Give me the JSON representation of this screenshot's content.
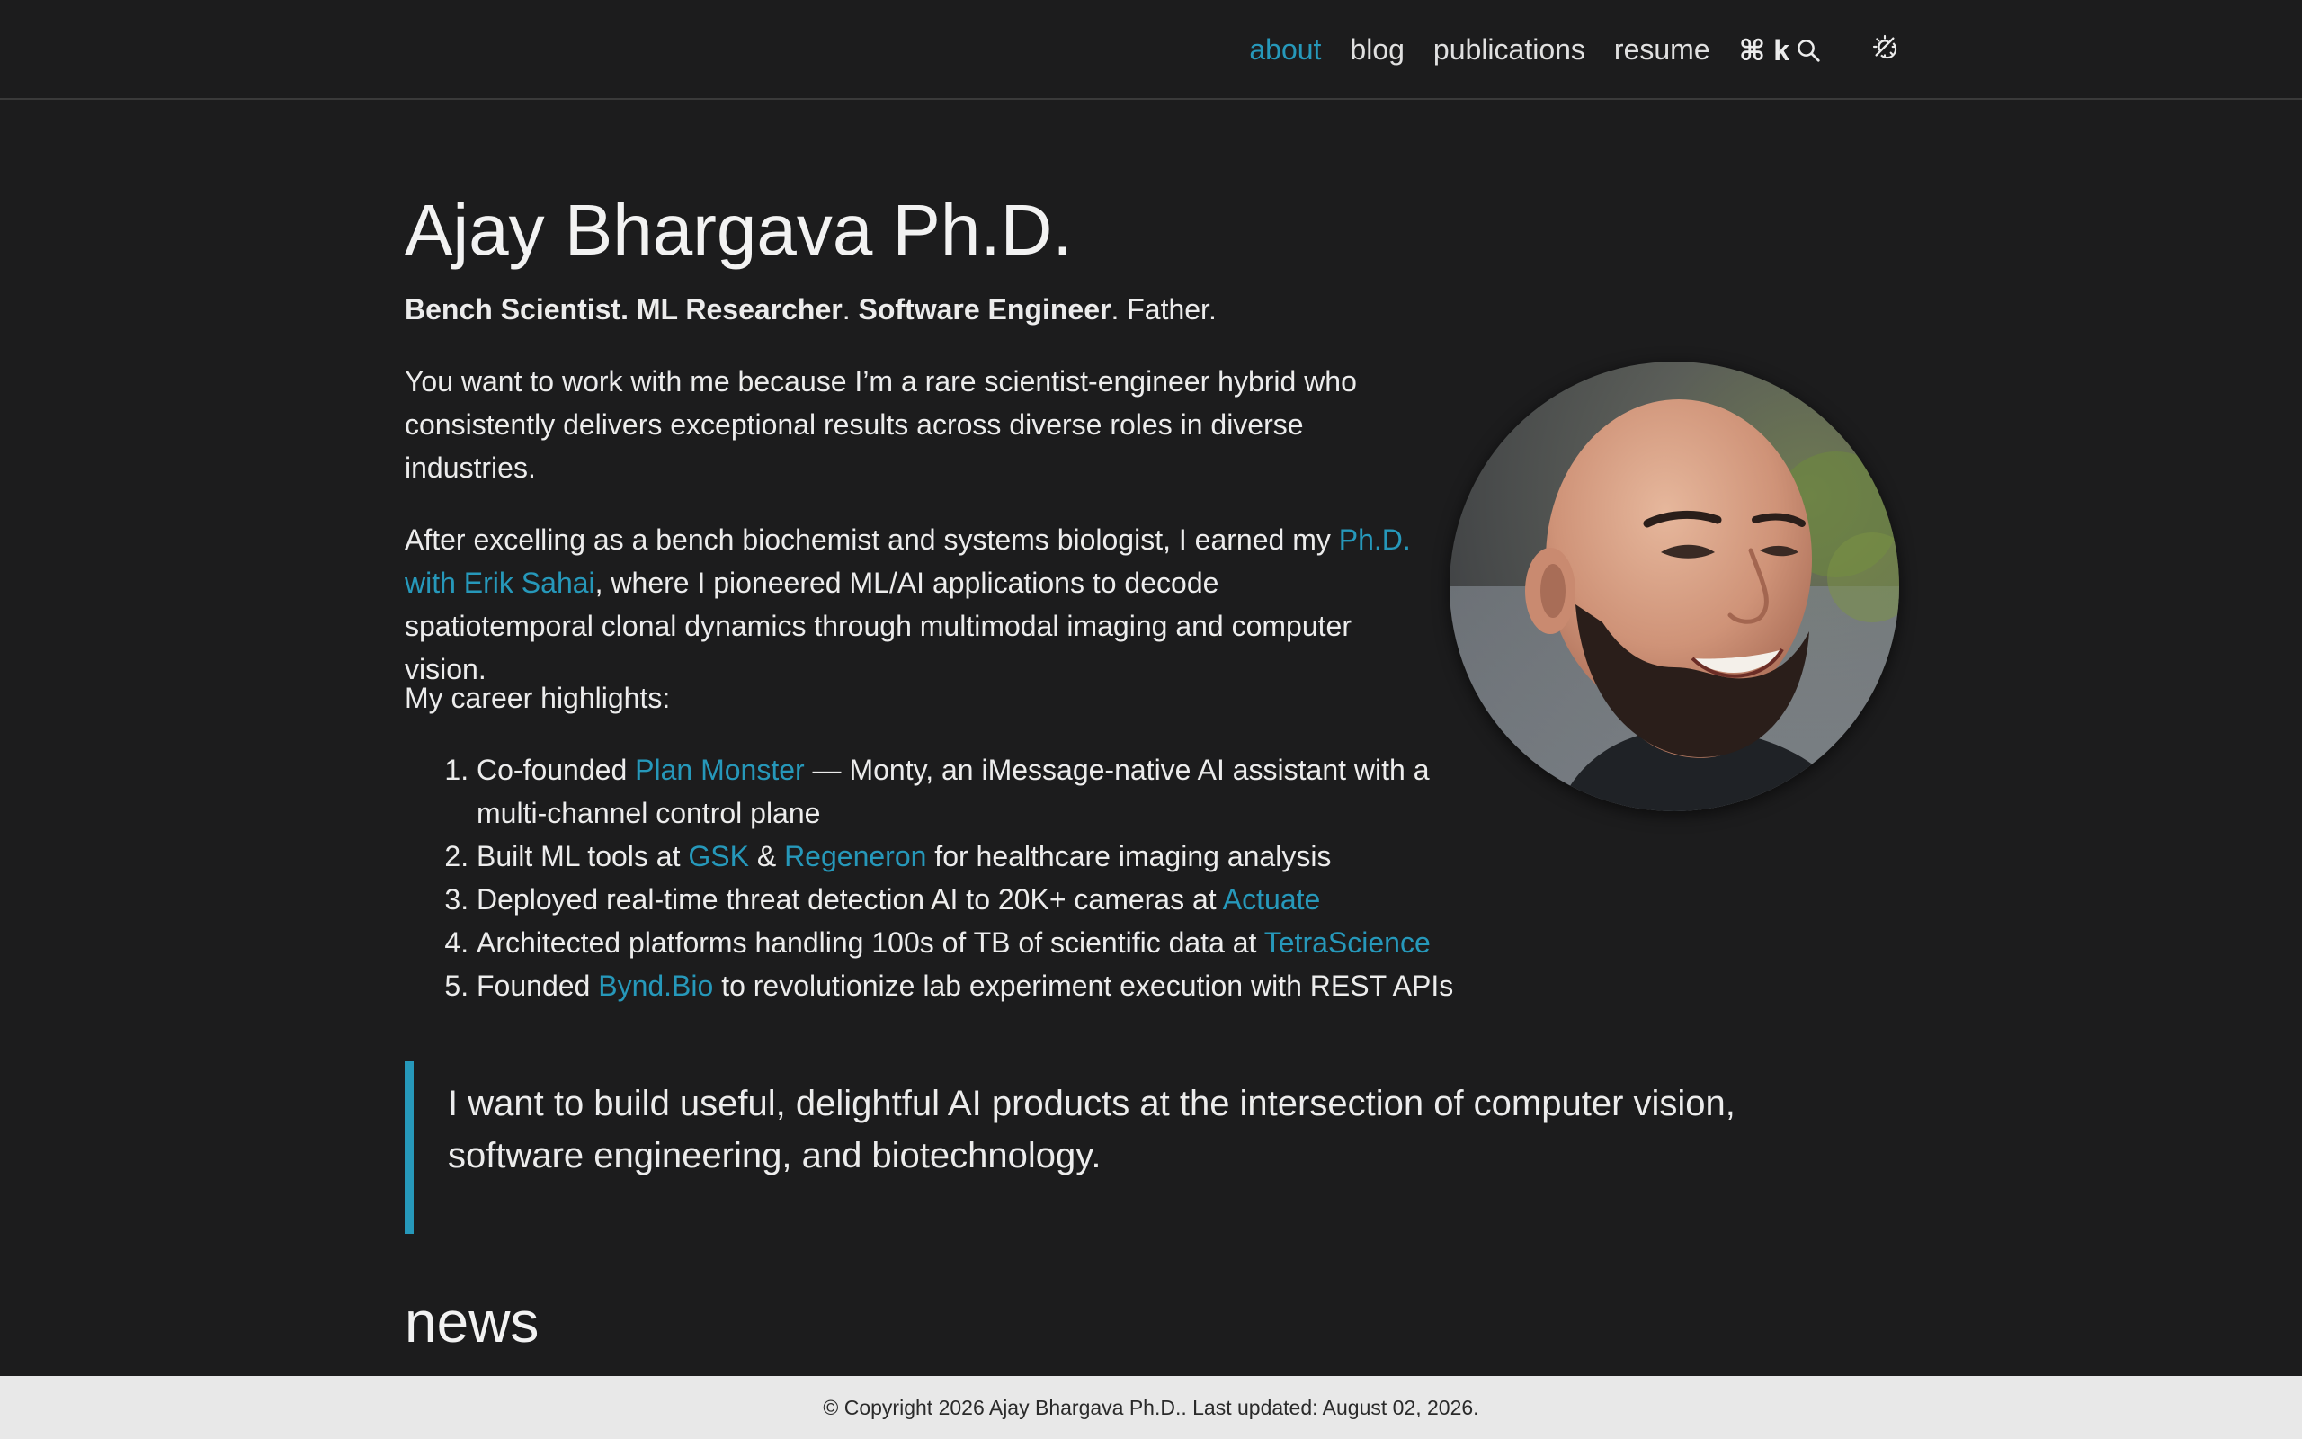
{
  "nav": {
    "items": [
      {
        "label": "about",
        "active": true
      },
      {
        "label": "blog",
        "active": false
      },
      {
        "label": "publications",
        "active": false
      },
      {
        "label": "resume",
        "active": false
      }
    ],
    "search_shortcut": "⌘ k",
    "search_icon": "search-icon",
    "theme_icon": "theme-toggle-icon"
  },
  "header": {
    "title": "Ajay Bhargava Ph.D.",
    "subtitle_bold_1": "Bench Scientist. ML Researcher",
    "subtitle_sep_1": ". ",
    "subtitle_bold_2": "Software Engineer",
    "subtitle_tail": ". Father."
  },
  "intro": {
    "p1": "You want to work with me because I’m a rare scientist-engineer hybrid who consistently delivers exceptional results across diverse roles in diverse industries.",
    "p2_pre": "After excelling as a bench biochemist and systems biologist, I earned my ",
    "p2_link": "Ph.D. with Erik Sahai",
    "p2_post": ", where I pioneered ML/AI applications to decode spatiotemporal clonal dynamics through multimodal imaging and computer vision.",
    "p3": "My career highlights:"
  },
  "highlights": [
    {
      "pre": "Co-founded ",
      "link": "Plan Monster",
      "post": " — Monty, an iMessage-native AI assistant with a multi-channel control plane"
    },
    {
      "pre": "Built ML tools at ",
      "link": "GSK",
      "mid": " & ",
      "link2": "Regeneron",
      "post": " for healthcare imaging analysis"
    },
    {
      "pre": "Deployed real-time threat detection AI to 20K+ cameras at ",
      "link": "Actuate",
      "post": ""
    },
    {
      "pre": "Architected platforms handling 100s of TB of scientific data at ",
      "link": "TetraScience",
      "post": ""
    },
    {
      "pre": "Founded ",
      "link": "Bynd.Bio",
      "post": " to revolutionize lab experiment execution with REST APIs"
    }
  ],
  "quote": "I want to build useful, delightful AI products at the intersection of computer vision, software engineering, and biotechnology.",
  "news_heading": "news",
  "footer": "© Copyright 2026 Ajay Bhargava Ph.D.. Last updated: August 02, 2026.",
  "colors": {
    "background": "#1c1c1d",
    "accent": "#2698ba",
    "text": "#ececec",
    "footer_bg": "#e8e8e8"
  }
}
